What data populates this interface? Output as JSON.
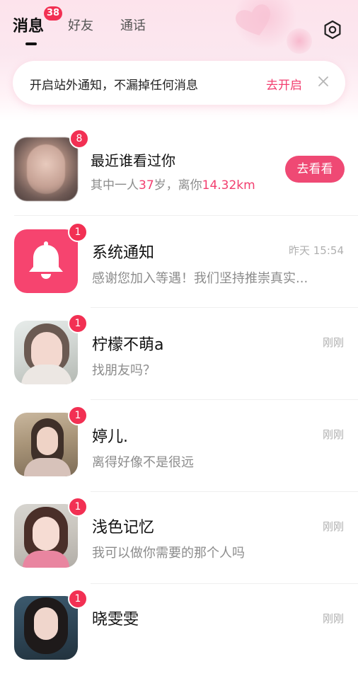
{
  "header": {
    "tabs": [
      {
        "label": "消息",
        "active": true,
        "badge": "38"
      },
      {
        "label": "好友",
        "active": false
      },
      {
        "label": "通话",
        "active": false
      }
    ],
    "settings_icon": "settings-gear-icon"
  },
  "banner": {
    "text": "开启站外通知，不漏掉任何消息",
    "action": "去开启",
    "close_icon": "close-icon"
  },
  "visitors": {
    "title": "最近谁看过你",
    "badge": "8",
    "desc_prefix": "其中一人",
    "age": "37",
    "age_unit": "岁，离你",
    "distance": "14.32km",
    "button": "去看看"
  },
  "conversations": [
    {
      "name": "系统通知",
      "preview": "感谢您加入等遇！我们坚持推崇真实...",
      "time": "昨天 15:54",
      "badge": "1",
      "avatar": "bell-icon"
    },
    {
      "name": "柠檬不萌a",
      "preview": "找朋友吗？",
      "time": "刚刚",
      "badge": "1"
    },
    {
      "name": "婷儿.",
      "preview": "离得好像不是很远",
      "time": "刚刚",
      "badge": "1"
    },
    {
      "name": "浅色记忆",
      "preview": "我可以做你需要的那个人吗",
      "time": "刚刚",
      "badge": "1"
    },
    {
      "name": "晓雯雯",
      "preview": "",
      "time": "刚刚",
      "badge": "1"
    }
  ],
  "colors": {
    "accent": "#f23e6f",
    "badge": "#f23053",
    "button": "#ef4974",
    "bell_tile": "#f6446f"
  }
}
